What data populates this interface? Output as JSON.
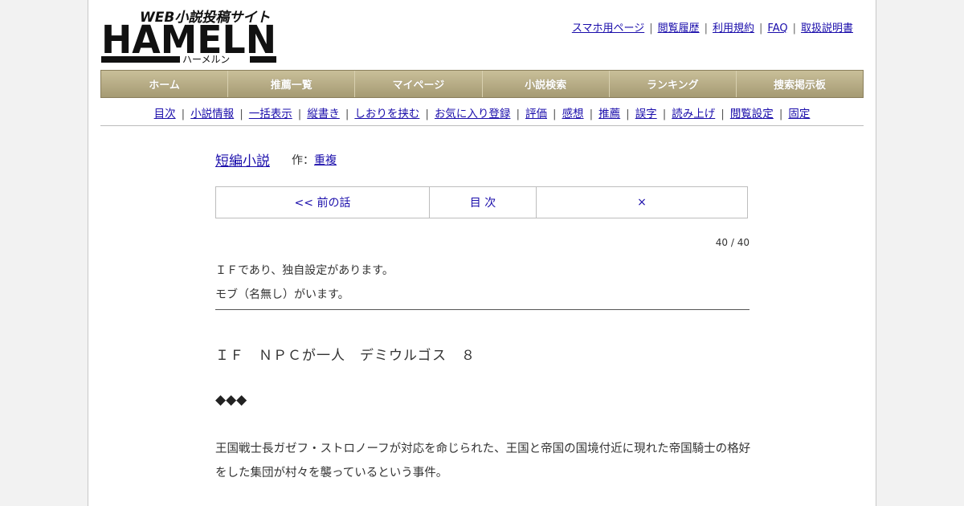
{
  "logo": {
    "subtitle_jp": "WEB小説投稿サイト",
    "wordmark": "HAMELN",
    "reading": "ハーメルン"
  },
  "header_links": [
    "スマホ用ページ",
    "閲覧履歴",
    "利用規約",
    "FAQ",
    "取扱説明書"
  ],
  "main_nav": [
    "ホーム",
    "推薦一覧",
    "マイページ",
    "小説検索",
    "ランキング",
    "捜索掲示板"
  ],
  "sub_nav": [
    "目次",
    "小説情報",
    "一括表示",
    "縦書き",
    "しおりを挟む",
    "お気に入り登録",
    "評価",
    "感想",
    "推薦",
    "誤字",
    "読み上げ",
    "閲覧設定",
    "固定"
  ],
  "novel": {
    "series_link": "短編小説",
    "author_prefix": "作：",
    "author": "重複"
  },
  "chapter_nav": {
    "prev": "<< 前の話",
    "toc": "目 次",
    "close": "×"
  },
  "page_count": "40 / 40",
  "preface": [
    "ＩＦであり、独自設定があります。",
    "モブ（名無し）がいます。"
  ],
  "chapter_title": "ＩＦ　ＮＰＣが一人　デミウルゴス　８",
  "separator": "◆◆◆",
  "body": "王国戦士長ガゼフ・ストロノーフが対応を命じられた、王国と帝国の国境付近に現れた帝国騎士の格好をした集団が村々を襲っているという事件。",
  "colors": {
    "nav_gold": "#b3a882",
    "link": "#1a0dab"
  }
}
